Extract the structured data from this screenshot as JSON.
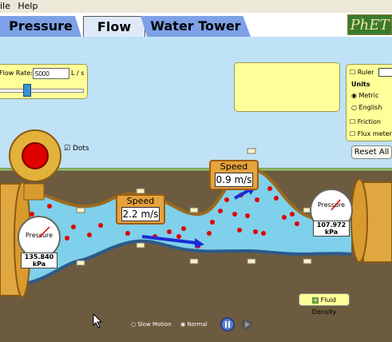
{
  "menu": {
    "items": [
      "ile",
      "Help"
    ]
  },
  "tabs": [
    {
      "label": "Pressure"
    },
    {
      "label": "Flow"
    },
    {
      "label": "Water Tower"
    }
  ],
  "brand": {
    "logo_text": "PhET"
  },
  "flow_rate": {
    "label": "Flow Rate:",
    "value": "5000",
    "unit": "L / s",
    "slider_fraction": 0.3
  },
  "options": {
    "ruler_label": "Ruler",
    "units_title": "Units",
    "metric_label": "Metric",
    "english_label": "English",
    "friction_label": "Friction",
    "flux_meter_label": "Flux meter",
    "selected_unit": "Metric"
  },
  "reset_all_label": "Reset All",
  "dots_label": "Dots",
  "speed_readouts": [
    {
      "title": "Speed",
      "value": "2.2 m/s"
    },
    {
      "title": "Speed",
      "value": "0.9 m/s"
    }
  ],
  "gauges": [
    {
      "title": "Pressure",
      "reading": "135.840 kPa"
    },
    {
      "title": "Pressure",
      "reading": "107.972 kPa"
    }
  ],
  "fluid_density_label": "Fluid Density",
  "playback": {
    "slow_motion_label": "Slow Motion",
    "normal_label": "Normal",
    "selected": "Normal"
  },
  "colors": {
    "sky": "#bfe2f6",
    "ground": "#6c5b3f",
    "water": "#7fd0ea",
    "pipe": "#e0a640",
    "tab_active": "#dfe9f7",
    "tab_inactive": "#7da0e6",
    "panel": "#ffff99",
    "particle": "#e00000"
  }
}
